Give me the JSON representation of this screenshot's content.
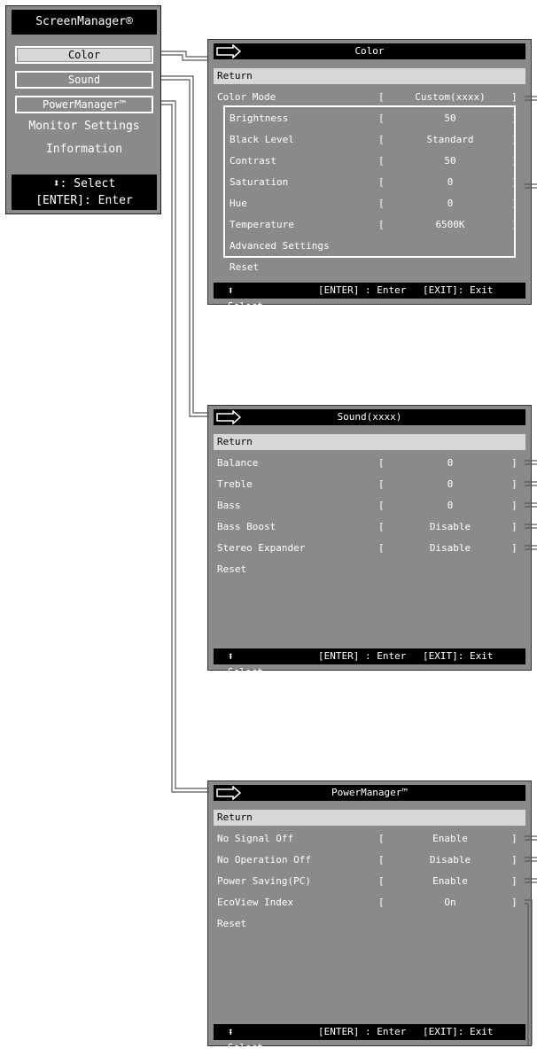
{
  "main_menu": {
    "title": "ScreenManager®",
    "items": [
      "Color",
      "Sound",
      "PowerManager™",
      "Monitor Settings",
      "Information"
    ],
    "footer": [
      ": Select",
      "[ENTER]: Enter"
    ]
  },
  "color_panel": {
    "title": "Color",
    "return": "Return",
    "rows": [
      {
        "label": "Color Mode",
        "value": "Custom(xxxx)"
      },
      {
        "label": "Brightness",
        "value": "50"
      },
      {
        "label": "Black Level",
        "value": "Standard"
      },
      {
        "label": "Contrast",
        "value": "50"
      },
      {
        "label": "Saturation",
        "value": "0"
      },
      {
        "label": "Hue",
        "value": "0"
      },
      {
        "label": "Temperature",
        "value": "6500K"
      }
    ],
    "advanced": "Advanced Settings",
    "reset": "Reset"
  },
  "sound_panel": {
    "title": "Sound(xxxx)",
    "return": "Return",
    "rows": [
      {
        "label": "Balance",
        "value": "0"
      },
      {
        "label": "Treble",
        "value": "0"
      },
      {
        "label": "Bass",
        "value": "0"
      },
      {
        "label": "Bass Boost",
        "value": "Disable"
      },
      {
        "label": "Stereo Expander",
        "value": "Disable"
      }
    ],
    "reset": "Reset"
  },
  "power_panel": {
    "title": "PowerManager™",
    "return": "Return",
    "rows": [
      {
        "label": "No Signal Off",
        "value": "Enable"
      },
      {
        "label": "No Operation Off",
        "value": "Disable"
      },
      {
        "label": "Power Saving(PC)",
        "value": "Enable"
      },
      {
        "label": "EcoView Index",
        "value": "On"
      }
    ],
    "reset": "Reset"
  },
  "panel_footer": {
    "select": ": Select",
    "enter": "[ENTER] : Enter",
    "exit": "[EXIT]: Exit"
  },
  "brackets": {
    "open": "[",
    "close": "]"
  },
  "glyphs": {
    "updown": "⬍",
    "arrow": "⇒"
  },
  "colors": {
    "panel_bg": "#8a8a8a",
    "highlight": "#d7d7d7",
    "bar": "#000000",
    "text": "#ffffff"
  }
}
